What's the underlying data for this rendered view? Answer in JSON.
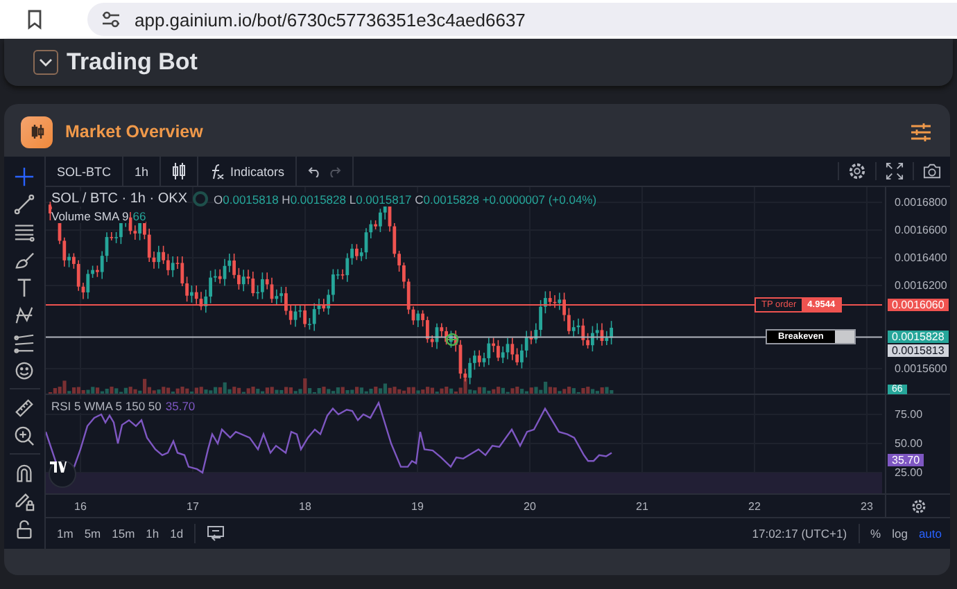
{
  "browser": {
    "url": "app.gainium.io/bot/6730c57736351e3c4aed6637"
  },
  "page_header": {
    "title": "Trading Bot"
  },
  "card": {
    "title": "Market Overview"
  },
  "chart": {
    "toolbar": {
      "symbol": "SOL-BTC",
      "interval": "1h",
      "indicators_label": "Indicators"
    },
    "legend": {
      "title": "SOL / BTC · 1h · OKX",
      "ohlc": [
        {
          "label": "O",
          "value": "0.0015818"
        },
        {
          "label": "H",
          "value": "0.0015828"
        },
        {
          "label": "L",
          "value": "0.0015817"
        },
        {
          "label": "C",
          "value": "0.0015828"
        }
      ],
      "change": "+0.0000007 (+0.04%)",
      "volume_label": "Volume SMA 9",
      "volume_value": "66"
    },
    "price_axis": [
      "0.0016800",
      "0.0016600",
      "0.0016400",
      "0.0016200",
      "0.0015600"
    ],
    "price_lines": [
      {
        "kind": "tp",
        "label": "TP order",
        "value": "4.9544",
        "price": "0.0016060"
      },
      {
        "kind": "breakeven",
        "label": "Breakeven",
        "price": "0.0015813"
      }
    ],
    "last_price": "0.0015828",
    "volume_badge": "66",
    "rsi": {
      "title": "RSI 5 WMA 5 150 50",
      "value": "35.70",
      "axis": [
        "75.00",
        "50.00",
        "25.00"
      ],
      "badge": "35.70"
    },
    "dates": [
      "16",
      "17",
      "18",
      "19",
      "20",
      "21",
      "22",
      "23"
    ],
    "timeframes": [
      "1m",
      "5m",
      "15m",
      "1h",
      "1d"
    ],
    "clock": "17:02:17 (UTC+1)",
    "scale_options": [
      {
        "label": "%",
        "selected": false
      },
      {
        "label": "log",
        "selected": false
      },
      {
        "label": "auto",
        "selected": true
      }
    ]
  }
}
